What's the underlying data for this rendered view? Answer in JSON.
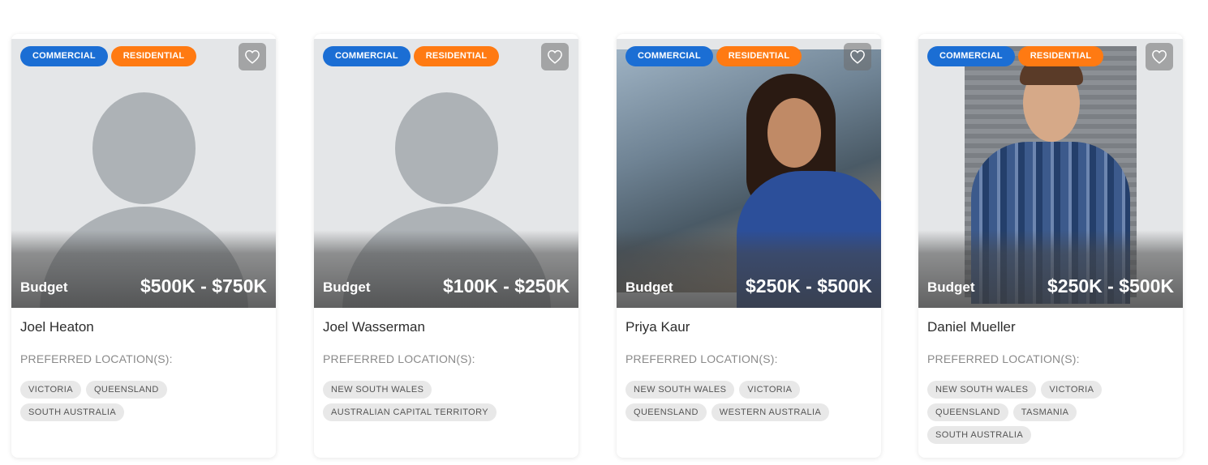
{
  "cards": [
    {
      "tags": [
        "COMMERCIAL",
        "RESIDENTIAL"
      ],
      "favorite_icon": "heart-outline-icon",
      "image": "avatar-placeholder",
      "budget_label": "Budget",
      "budget_value": "$500K - $750K",
      "name": "Joel Heaton",
      "locations_title": "PREFERRED LOCATION(S):",
      "locations": [
        "VICTORIA",
        "QUEENSLAND",
        "SOUTH AUSTRALIA"
      ]
    },
    {
      "tags": [
        "COMMERCIAL",
        "RESIDENTIAL"
      ],
      "favorite_icon": "heart-outline-icon",
      "image": "avatar-placeholder",
      "budget_label": "Budget",
      "budget_value": "$100K - $250K",
      "name": "Joel Wasserman",
      "locations_title": "PREFERRED LOCATION(S):",
      "locations": [
        "NEW SOUTH WALES",
        "AUSTRALIAN CAPITAL TERRITORY"
      ]
    },
    {
      "tags": [
        "COMMERCIAL",
        "RESIDENTIAL"
      ],
      "favorite_icon": "heart-outline-icon",
      "image": "photo",
      "budget_label": "Budget",
      "budget_value": "$250K - $500K",
      "name": "Priya Kaur",
      "locations_title": "PREFERRED LOCATION(S):",
      "locations": [
        "NEW SOUTH WALES",
        "VICTORIA",
        "QUEENSLAND",
        "WESTERN AUSTRALIA"
      ]
    },
    {
      "tags": [
        "COMMERCIAL",
        "RESIDENTIAL"
      ],
      "favorite_icon": "heart-outline-icon",
      "image": "photo",
      "budget_label": "Budget",
      "budget_value": "$250K - $500K",
      "name": "Daniel Mueller",
      "locations_title": "PREFERRED LOCATION(S):",
      "locations": [
        "NEW SOUTH WALES",
        "VICTORIA",
        "QUEENSLAND",
        "TASMANIA",
        "SOUTH AUSTRALIA"
      ]
    }
  ],
  "colors": {
    "commercial_tag": "#1b6ed4",
    "residential_tag": "#ff7a12",
    "location_chip_bg": "#e8e8e8"
  }
}
